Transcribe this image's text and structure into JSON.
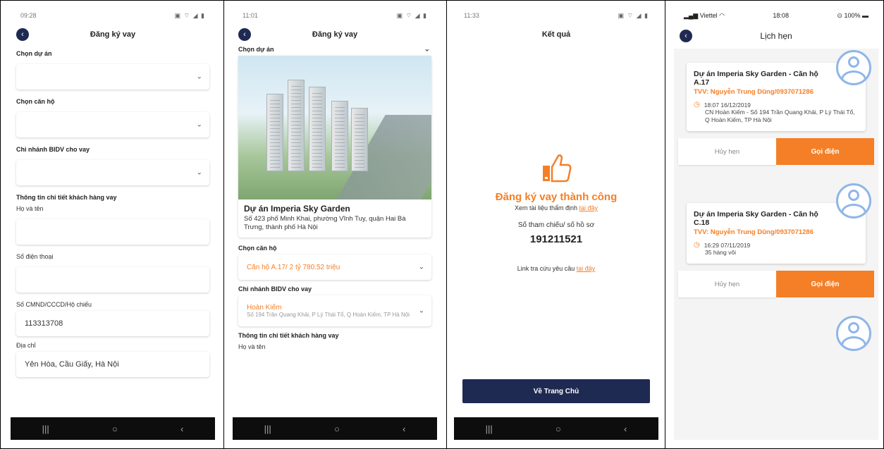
{
  "colors": {
    "accent": "#f47f27",
    "navy": "#1f2a52"
  },
  "screen1": {
    "status_time": "09:28",
    "status_icons": "▣ ⌔ ◢ ▮",
    "title": "Đăng ký vay",
    "label_project": "Chọn dự án",
    "label_apartment": "Chọn căn hộ",
    "label_branch": "Chi nhánh BIDV cho vay",
    "section_customer": "Thông tin chi tiết khách hàng vay",
    "label_name": "Họ và tên",
    "label_phone": "Số điện thoại",
    "label_id": "Số CMND/CCCD/Hộ chiếu",
    "id_value": "113313708",
    "label_address": "Địa chỉ",
    "address_value": "Yên Hòa, Cầu Giấy, Hà Nội"
  },
  "screen2": {
    "status_time": "11:01",
    "status_icons": "▣ ⌔ ◢ ▮",
    "title": "Đăng ký vay",
    "label_project": "Chọn dự án",
    "project_name": "Dự án Imperia Sky Garden",
    "project_address": "Số 423 phố Minh Khai, phường Vĩnh Tuy, quận Hai Bà Trưng, thành phố Hà Nội",
    "label_apartment": "Chọn căn hộ",
    "apartment_value": "Căn hộ A.17/ 2 tỷ 780.52 triệu",
    "label_branch": "Chi nhánh BIDV cho vay",
    "branch_name": "Hoàn Kiếm",
    "branch_address": "Số 194 Trần Quang Khải, P Lý Thái Tổ, Q Hoàn Kiếm, TP Hà Nội",
    "section_customer": "Thông tin chi tiết khách hàng vay",
    "label_name": "Họ và tên"
  },
  "screen3": {
    "status_time": "11:33",
    "status_icons": "▣ ⌔ ◢ ▮",
    "title": "Kết quả",
    "success_text": "Đăng ký vay thành công",
    "doc_text": "Xem tài liệu thẩm định",
    "doc_link": "tại đây",
    "ref_label": "Số tham chiếu/ số hồ sơ",
    "ref_number": "191211521",
    "lookup_text": "Link tra cứu yêu cầu",
    "lookup_link": "tại đây",
    "home_button": "Về Trang Chủ"
  },
  "screen4": {
    "status_carrier": "Viettel",
    "status_time": "18:08",
    "status_battery": "100%",
    "title": "Lịch hẹn",
    "appointments": [
      {
        "title": "Dự án Imperia Sky Garden - Căn hộ A.17",
        "consultant": "TVV: Nguyễn Trung Dũng/0937071286",
        "time": "18:07 16/12/2019",
        "note": "CN Hoàn Kiếm - Số 194 Trần Quang Khải, P Lý Thái Tổ, Q Hoàn Kiếm, TP Hà Nội",
        "cancel_label": "Hủy hẹn",
        "call_label": "Gọi điện"
      },
      {
        "title": "Dự án Imperia Sky Garden - Căn hộ C.18",
        "consultant": "TVV: Nguyễn Trung Dũng/0937071286",
        "time": "16:29 07/11/2019",
        "note": "35 hàng vôi",
        "cancel_label": "Hủy hẹn",
        "call_label": "Gọi điện"
      }
    ]
  },
  "navbar": {
    "recent": "|||",
    "home": "○",
    "back": "‹"
  }
}
